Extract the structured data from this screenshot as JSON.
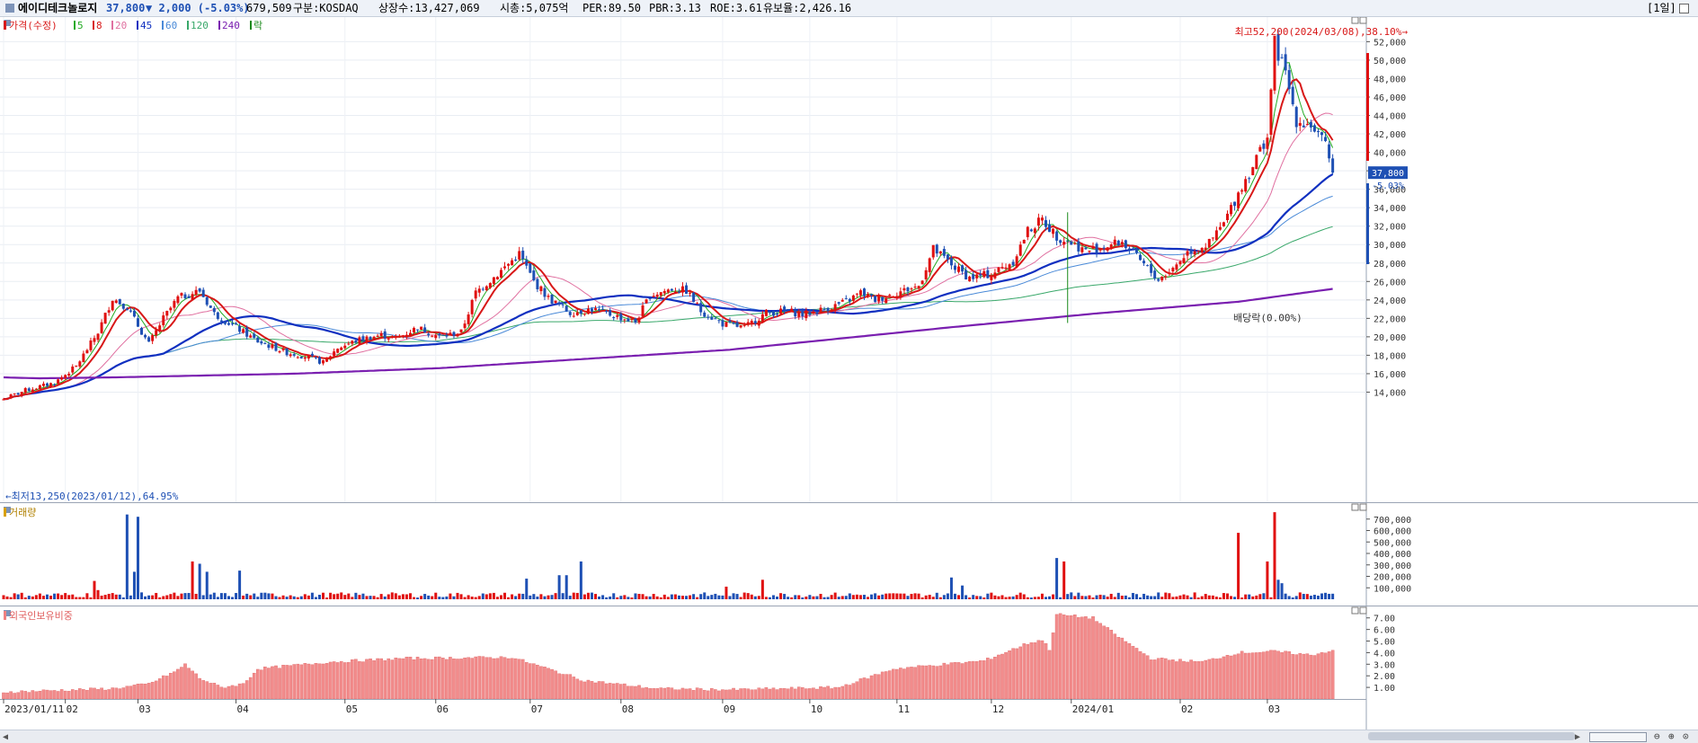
{
  "header": {
    "name": "에이디테크놀로지",
    "price": "37,800",
    "change": "▼ 2,000 (-5.03%)",
    "volume": "679,509",
    "market": "구분:KOSDAQ",
    "shares": "상장수:13,427,069",
    "cap": "시총:5,075억",
    "per": "PER:89.50",
    "pbr": "PBR:3.13",
    "roe": "ROE:3.61",
    "reserve": "유보율:2,426.16",
    "period": "[1일]",
    "colors": {
      "down": "#1e50b4",
      "up": "#e01010"
    }
  },
  "legend": {
    "title": "가격(수정)",
    "items": [
      {
        "label": "5",
        "color": "#22aa22"
      },
      {
        "label": "8",
        "color": "#d81818"
      },
      {
        "label": "20",
        "color": "#e070a0"
      },
      {
        "label": "45",
        "color": "#1030c0"
      },
      {
        "label": "60",
        "color": "#4a8ad8"
      },
      {
        "label": "120",
        "color": "#39a86a"
      },
      {
        "label": "240",
        "color": "#7a1fb0"
      },
      {
        "label": "락",
        "color": "#1a8a1a"
      }
    ]
  },
  "volume_panel": {
    "title": "거래량"
  },
  "foreign_panel": {
    "title": "외국인보유비중"
  },
  "annotations": {
    "high": "최고52,200(2024/03/08),38.10%→",
    "low": "←최저13,250(2023/01/12),64.95%",
    "dividend": "배당락(0.00%)"
  },
  "price_labels": {
    "current": "37,800",
    "change_pct": "-5.03%"
  },
  "chart_data": [
    {
      "type": "candlestick",
      "title": "가격(수정)",
      "y_ticks": [
        "14,000",
        "16,000",
        "18,000",
        "20,000",
        "22,000",
        "24,000",
        "26,000",
        "28,000",
        "30,000",
        "32,000",
        "34,000",
        "36,000",
        "38,000",
        "40,000",
        "42,000",
        "44,000",
        "46,000",
        "48,000",
        "50,000",
        "52,000"
      ],
      "ylim": [
        12000,
        53500
      ],
      "x_labels": [
        "2023/01/11",
        "02",
        "03",
        "04",
        "05",
        "06",
        "07",
        "08",
        "09",
        "10",
        "11",
        "12",
        "2024/01",
        "02",
        "03"
      ],
      "anchors": [
        [
          0,
          13250
        ],
        [
          6,
          14200
        ],
        [
          14,
          15000
        ],
        [
          20,
          16800
        ],
        [
          26,
          20500
        ],
        [
          30,
          24200
        ],
        [
          34,
          23200
        ],
        [
          40,
          19200
        ],
        [
          44,
          22000
        ],
        [
          48,
          24200
        ],
        [
          54,
          25000
        ],
        [
          58,
          22500
        ],
        [
          64,
          21000
        ],
        [
          70,
          19500
        ],
        [
          78,
          18300
        ],
        [
          84,
          17800
        ],
        [
          88,
          17200
        ],
        [
          92,
          18800
        ],
        [
          98,
          19700
        ],
        [
          104,
          20200
        ],
        [
          108,
          19800
        ],
        [
          114,
          21000
        ],
        [
          120,
          20000
        ],
        [
          126,
          20500
        ],
        [
          130,
          24800
        ],
        [
          136,
          26800
        ],
        [
          142,
          29000
        ],
        [
          146,
          26000
        ],
        [
          150,
          24200
        ],
        [
          156,
          22600
        ],
        [
          162,
          23000
        ],
        [
          168,
          22300
        ],
        [
          174,
          21600
        ],
        [
          178,
          24500
        ],
        [
          184,
          25200
        ],
        [
          188,
          25000
        ],
        [
          192,
          22800
        ],
        [
          198,
          21400
        ],
        [
          204,
          21000
        ],
        [
          210,
          22600
        ],
        [
          216,
          22800
        ],
        [
          220,
          22400
        ],
        [
          226,
          23000
        ],
        [
          232,
          23800
        ],
        [
          236,
          24800
        ],
        [
          240,
          24000
        ],
        [
          246,
          24800
        ],
        [
          252,
          25500
        ],
        [
          256,
          29500
        ],
        [
          262,
          27500
        ],
        [
          266,
          26400
        ],
        [
          272,
          26800
        ],
        [
          278,
          28200
        ],
        [
          282,
          31500
        ],
        [
          286,
          32700
        ],
        [
          290,
          30900
        ],
        [
          294,
          30200
        ],
        [
          298,
          29300
        ],
        [
          302,
          29700
        ],
        [
          308,
          30300
        ],
        [
          314,
          27800
        ],
        [
          318,
          26200
        ],
        [
          322,
          27400
        ],
        [
          326,
          29200
        ],
        [
          332,
          30100
        ],
        [
          336,
          32300
        ],
        [
          340,
          35600
        ],
        [
          344,
          38600
        ],
        [
          348,
          41800
        ],
        [
          350,
          51800
        ],
        [
          353,
          48500
        ],
        [
          356,
          43500
        ],
        [
          360,
          43000
        ],
        [
          364,
          40600
        ],
        [
          366,
          37800
        ]
      ],
      "ma_windows": [
        5,
        8,
        20,
        45,
        60,
        120,
        240
      ],
      "ma240_anchors": [
        [
          0,
          15600
        ],
        [
          10,
          15500
        ],
        [
          30,
          15600
        ],
        [
          80,
          16000
        ],
        [
          120,
          16600
        ],
        [
          200,
          18600
        ],
        [
          260,
          21000
        ],
        [
          300,
          22500
        ],
        [
          340,
          23800
        ],
        [
          366,
          25200
        ]
      ],
      "last_close": 37800,
      "high": 52200,
      "low": 13250
    },
    {
      "type": "bar",
      "title": "거래량",
      "y_ticks": [
        "100,000",
        "200,000",
        "300,000",
        "400,000",
        "500,000",
        "600,000",
        "700,000"
      ],
      "ylim": [
        0,
        800000
      ],
      "spikes": [
        [
          25,
          160000
        ],
        [
          26,
          80000
        ],
        [
          34,
          740000
        ],
        [
          36,
          240000
        ],
        [
          37,
          720000
        ],
        [
          52,
          330000
        ],
        [
          54,
          310000
        ],
        [
          56,
          240000
        ],
        [
          65,
          250000
        ],
        [
          144,
          180000
        ],
        [
          153,
          210000
        ],
        [
          155,
          210000
        ],
        [
          159,
          330000
        ],
        [
          199,
          110000
        ],
        [
          209,
          170000
        ],
        [
          261,
          190000
        ],
        [
          264,
          120000
        ],
        [
          290,
          360000
        ],
        [
          292,
          330000
        ],
        [
          340,
          580000
        ],
        [
          350,
          760000
        ],
        [
          351,
          170000
        ],
        [
          348,
          330000
        ],
        [
          352,
          140000
        ]
      ]
    },
    {
      "type": "bar",
      "title": "외국인보유비중",
      "y_ticks": [
        "1.00",
        "2.00",
        "3.00",
        "4.00",
        "5.00",
        "6.00",
        "7.00"
      ],
      "ylim": [
        0,
        7.6
      ],
      "anchors": [
        [
          0,
          0.6
        ],
        [
          30,
          0.9
        ],
        [
          40,
          1.3
        ],
        [
          48,
          2.5
        ],
        [
          50,
          3.0
        ],
        [
          54,
          1.8
        ],
        [
          60,
          1.0
        ],
        [
          66,
          1.3
        ],
        [
          70,
          2.6
        ],
        [
          90,
          3.2
        ],
        [
          110,
          3.5
        ],
        [
          140,
          3.6
        ],
        [
          160,
          1.6
        ],
        [
          180,
          0.9
        ],
        [
          200,
          0.8
        ],
        [
          230,
          1.0
        ],
        [
          245,
          2.6
        ],
        [
          270,
          3.3
        ],
        [
          282,
          4.8
        ],
        [
          286,
          5.1
        ],
        [
          288,
          4.3
        ],
        [
          290,
          7.3
        ],
        [
          300,
          7.0
        ],
        [
          306,
          5.6
        ],
        [
          316,
          3.5
        ],
        [
          330,
          3.2
        ],
        [
          340,
          4.0
        ],
        [
          350,
          4.1
        ],
        [
          360,
          3.8
        ],
        [
          366,
          4.2
        ]
      ]
    }
  ]
}
